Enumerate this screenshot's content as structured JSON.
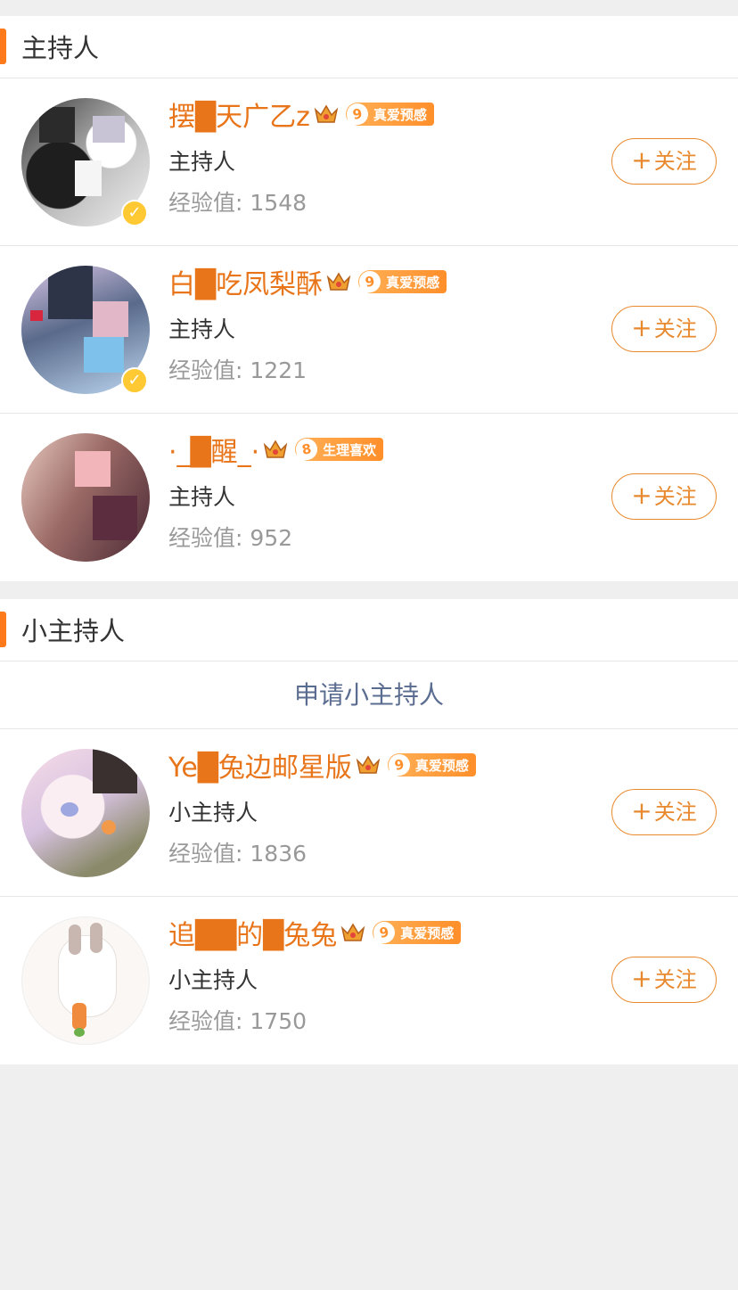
{
  "sections": [
    {
      "title": "主持人",
      "members": [
        {
          "name": "摆█天广乙z",
          "badge_level": "9",
          "badge_text": "真爱预感",
          "role": "主持人",
          "exp_label": "经验值:",
          "exp_value": "1548",
          "verified": true,
          "follow_label": "关注"
        },
        {
          "name": "白█吃凤梨酥",
          "badge_level": "9",
          "badge_text": "真爱预感",
          "role": "主持人",
          "exp_label": "经验值:",
          "exp_value": "1221",
          "verified": true,
          "follow_label": "关注"
        },
        {
          "name": "·_█醒_·",
          "badge_level": "8",
          "badge_text": "生理喜欢",
          "role": "主持人",
          "exp_label": "经验值:",
          "exp_value": "952",
          "verified": false,
          "follow_label": "关注"
        }
      ]
    },
    {
      "title": "小主持人",
      "apply_label": "申请小主持人",
      "members": [
        {
          "name": "Ye█兔边邮星版",
          "badge_level": "9",
          "badge_text": "真爱预感",
          "role": "小主持人",
          "exp_label": "经验值:",
          "exp_value": "1836",
          "verified": false,
          "follow_label": "关注"
        },
        {
          "name": "追██的█兔兔",
          "badge_level": "9",
          "badge_text": "真爱预感",
          "role": "小主持人",
          "exp_label": "经验值:",
          "exp_value": "1750",
          "verified": false,
          "follow_label": "关注"
        }
      ]
    }
  ],
  "icons": {
    "plus": "plus-icon",
    "crown": "crown-icon",
    "verified": "verified-check-icon",
    "badge": "level-badge-icon"
  },
  "colors": {
    "accent": "#ff7a1a",
    "name": "#e8751a",
    "follow": "#e8892e",
    "link": "#5a6c8f",
    "verified": "#ffc933"
  },
  "symbols": {
    "plus": "+",
    "check": "✓"
  }
}
